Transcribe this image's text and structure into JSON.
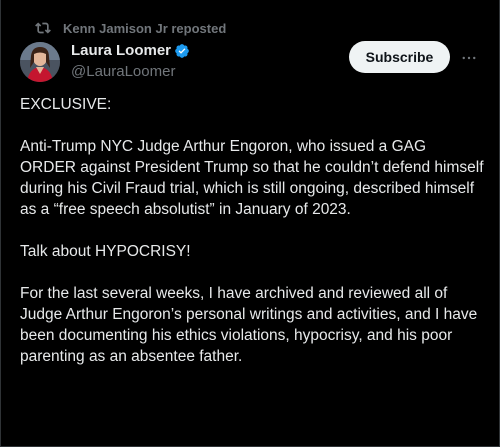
{
  "repost": {
    "text": "Kenn Jamison Jr reposted",
    "icon": "repost-icon"
  },
  "author": {
    "name": "Laura Loomer",
    "handle": "@LauraLoomer",
    "verified_icon": "verified-badge-icon",
    "verified_color": "#1d9bf0"
  },
  "actions": {
    "subscribe_label": "Subscribe",
    "more_icon": "more-horizontal-icon"
  },
  "post": {
    "paragraphs": [
      "EXCLUSIVE:",
      "Anti-Trump NYC Judge Arthur Engoron, who issued a GAG ORDER against President Trump so that he couldn’t defend himself during his Civil Fraud trial, which is still ongoing, described himself as a “free speech absolutist” in January of 2023.",
      "Talk about HYPOCRISY!",
      "For the last several weeks, I have archived and reviewed all of Judge Arthur Engoron’s personal writings and activities, and I have been documenting his ethics violations, hypocrisy, and his poor parenting as an absentee father."
    ]
  },
  "colors": {
    "background": "#000000",
    "text": "#e7e9ea",
    "secondary": "#71767b",
    "button_bg": "#eff3f4"
  }
}
